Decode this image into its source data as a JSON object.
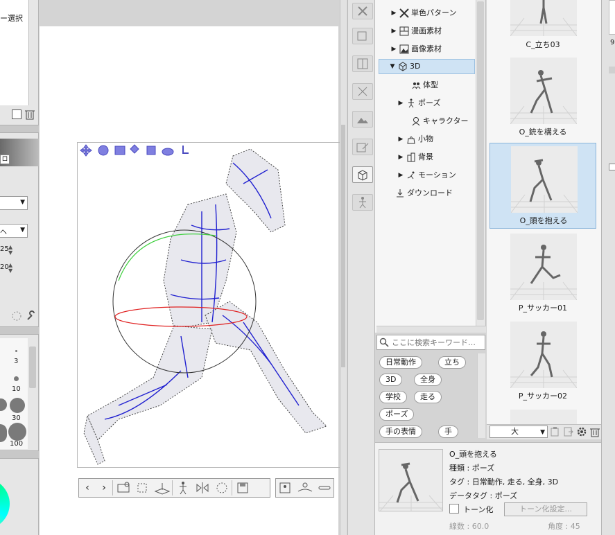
{
  "left_panel": {
    "layer_select_label": "ー選択",
    "field_value_1": "25",
    "field_value_2": "20",
    "brush_size_3": "3",
    "brush_size_10": "10",
    "brush_size_30": "30",
    "brush_size_100": "100"
  },
  "tree": {
    "items": [
      {
        "label": "単色パターン"
      },
      {
        "label": "漫画素材"
      },
      {
        "label": "画像素材"
      },
      {
        "label": "3D"
      },
      {
        "label": "体型"
      },
      {
        "label": "ポーズ"
      },
      {
        "label": "キャラクター"
      },
      {
        "label": "小物"
      },
      {
        "label": "背景"
      },
      {
        "label": "モーション"
      },
      {
        "label": "ダウンロード"
      }
    ]
  },
  "search": {
    "placeholder": "ここに検索キーワード…"
  },
  "tags": [
    "日常動作",
    "立ち",
    "3D",
    "全身",
    "学校",
    "走る",
    "ポーズ",
    "手の表情",
    "手"
  ],
  "thumbnails": [
    {
      "label": "C_立ち03"
    },
    {
      "label": "O_銃を構える"
    },
    {
      "label": "O_頭を抱える"
    },
    {
      "label": "P_サッカー01"
    },
    {
      "label": "P_サッカー02"
    }
  ],
  "thumb_toolbar": {
    "size_value": "大"
  },
  "detail": {
    "name": "O_頭を抱える",
    "kind": "種類 : ポーズ",
    "tags": "タグ : 日常動作, 走る, 全身, 3D",
    "data_tag": "データタグ : ポーズ",
    "tone_label": "トーン化",
    "tone_settings_button": "トーン化設定...",
    "line_count": "線数 : 60.0",
    "angle": "角度 : 45"
  },
  "right_edge": {
    "value": "9"
  },
  "colors": {
    "selection": "#cfe3f4",
    "gizmo_blue": "#5a5ad6",
    "mesh_blue": "#2020d0"
  }
}
